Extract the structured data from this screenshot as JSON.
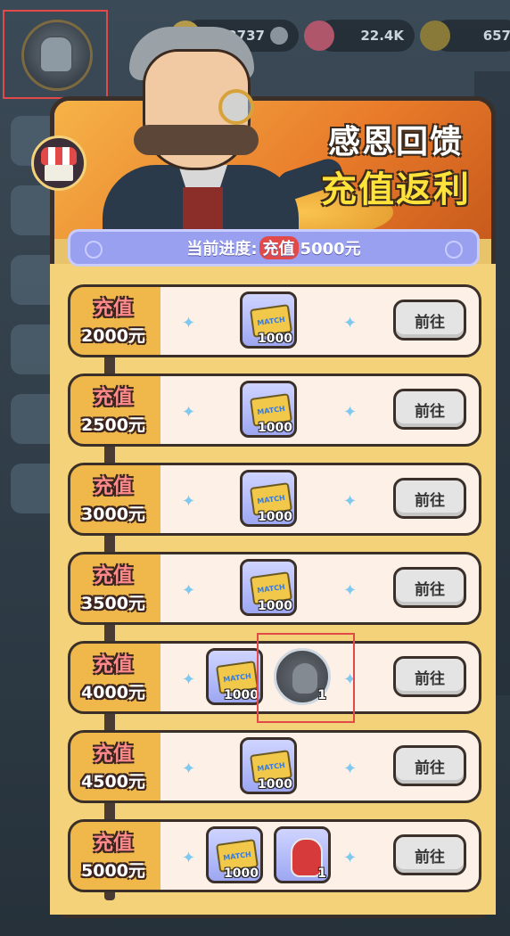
{
  "topbar": {
    "resource1": "2737",
    "resource2": "22.4K",
    "resource3": "657"
  },
  "header": {
    "title_line1": "感恩回馈",
    "title_line2": "充值返利"
  },
  "progress": {
    "prefix": "当前进度:",
    "highlight": "充值",
    "value": "5000元"
  },
  "tiers": [
    {
      "label1": "充值",
      "label2": "2000元",
      "button": "前往",
      "rewards": [
        {
          "type": "ticket",
          "text": "MATCH",
          "qty": "1000"
        }
      ]
    },
    {
      "label1": "充值",
      "label2": "2500元",
      "button": "前往",
      "rewards": [
        {
          "type": "ticket",
          "text": "MATCH",
          "qty": "1000"
        }
      ]
    },
    {
      "label1": "充值",
      "label2": "3000元",
      "button": "前往",
      "rewards": [
        {
          "type": "ticket",
          "text": "MATCH",
          "qty": "1000"
        }
      ]
    },
    {
      "label1": "充值",
      "label2": "3500元",
      "button": "前往",
      "rewards": [
        {
          "type": "ticket",
          "text": "MATCH",
          "qty": "1000"
        }
      ]
    },
    {
      "label1": "充值",
      "label2": "4000元",
      "button": "前往",
      "rewards": [
        {
          "type": "ticket",
          "text": "MATCH",
          "qty": "1000"
        },
        {
          "type": "avatar",
          "qty": "1"
        }
      ]
    },
    {
      "label1": "充值",
      "label2": "4500元",
      "button": "前往",
      "rewards": [
        {
          "type": "ticket",
          "text": "MATCH",
          "qty": "1000"
        }
      ]
    },
    {
      "label1": "充值",
      "label2": "5000元",
      "button": "前往",
      "rewards": [
        {
          "type": "ticket",
          "text": "MATCH",
          "qty": "1000"
        },
        {
          "type": "mask",
          "qty": "1"
        }
      ]
    }
  ]
}
